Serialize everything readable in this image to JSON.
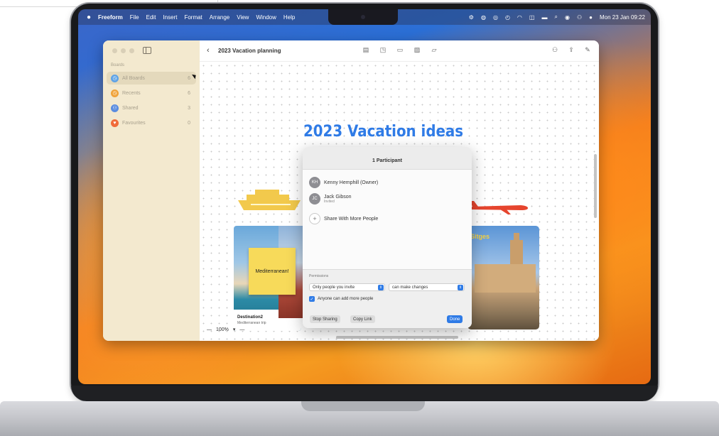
{
  "menubar": {
    "apple": "",
    "app": "Freeform",
    "items": [
      "File",
      "Edit",
      "Insert",
      "Format",
      "Arrange",
      "View",
      "Window",
      "Help"
    ],
    "datetime": "Mon 23 Jan 09:22"
  },
  "sidebar": {
    "heading": "Boards",
    "items": [
      {
        "label": "All Boards",
        "count": "6",
        "color": "#5fa3e6",
        "icon": "clock-icon"
      },
      {
        "label": "Recents",
        "count": "6",
        "color": "#f0a33a",
        "icon": "clock-icon"
      },
      {
        "label": "Shared",
        "count": "3",
        "color": "#5b8de0",
        "icon": "people-icon"
      },
      {
        "label": "Favourites",
        "count": "0",
        "color": "#f06b3a",
        "icon": "heart-icon"
      }
    ]
  },
  "toolbar": {
    "back": "‹",
    "title": "2023 Vacation planning"
  },
  "board": {
    "title": "2023 Vacation ideas",
    "sticky": "Mediterranean!",
    "caption": "Destination2",
    "caption_sub": "Mediterranean trip",
    "photo_label": "Sitges",
    "zoom": "100%"
  },
  "share": {
    "header": "1 Participant",
    "people": [
      {
        "initials": "KH",
        "name": "Kenny Hemphill (Owner)",
        "status": ""
      },
      {
        "initials": "JC",
        "name": "Jack Gibson",
        "status": "Invited"
      }
    ],
    "add_label": "Share With More People",
    "permissions_label": "Permissions",
    "who_select": "Only people you invite",
    "access_select": "can make changes",
    "checkbox_label": "Anyone can add more people",
    "stop_button": "Stop Sharing",
    "copy_button": "Copy Link",
    "done_button": "Done"
  }
}
